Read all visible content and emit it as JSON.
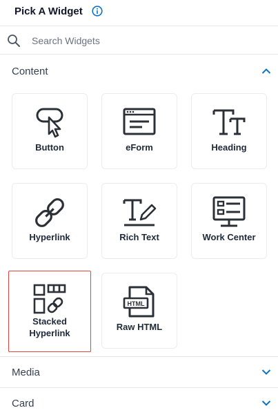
{
  "header": {
    "title": "Pick A Widget",
    "info_icon": "info-circle-icon"
  },
  "search": {
    "placeholder": "Search Widgets",
    "value": ""
  },
  "sections": {
    "content": {
      "label": "Content",
      "expanded": true
    },
    "media": {
      "label": "Media",
      "expanded": false
    },
    "card": {
      "label": "Card",
      "expanded": false
    }
  },
  "widgets": [
    {
      "label": "Button",
      "icon": "button-cursor-icon"
    },
    {
      "label": "eForm",
      "icon": "eform-window-icon"
    },
    {
      "label": "Heading",
      "icon": "heading-tt-icon"
    },
    {
      "label": "Hyperlink",
      "icon": "chain-link-icon"
    },
    {
      "label": "Rich Text",
      "icon": "rich-text-pen-icon"
    },
    {
      "label": "Work Center",
      "icon": "monitor-list-icon"
    },
    {
      "label": "Stacked\nHyperlink",
      "icon": "stacked-hyperlink-icon",
      "selected": true
    },
    {
      "label": "Raw HTML",
      "icon": "html-file-icon"
    }
  ],
  "colors": {
    "accent": "#0b72c4",
    "selected_border": "#e0443a",
    "icon_stroke": "#2b2f36"
  }
}
